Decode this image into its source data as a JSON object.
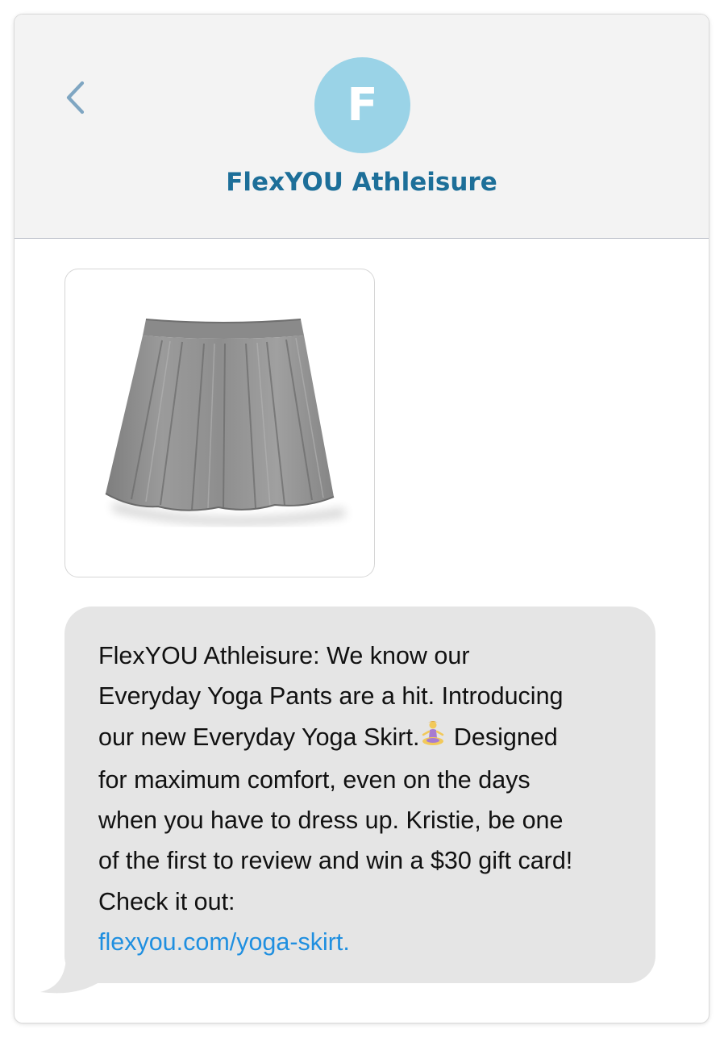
{
  "header": {
    "avatar_letter": "F",
    "sender_name": "FlexYOU Athleisure"
  },
  "message": {
    "line1": "FlexYOU Athleisure: We know our",
    "line2": "Everyday Yoga Pants are a hit. Introducing",
    "line3_before_emoji": "our new Everyday Yoga Skirt.",
    "line3_after_emoji": " Designed",
    "line4": "for maximum comfort, even on the days",
    "line5": "when you have to dress up. Kristie, be one",
    "line6": "of the first to review and win a $30 gift card!",
    "line7": "Check it out:",
    "link": "flexyou.com/yoga-skirt."
  },
  "icons": {
    "back": "chevron-left-icon",
    "emoji": "person-in-lotus-position-emoji"
  },
  "colors": {
    "accent": "#1d6f99",
    "avatar_bg": "#9ad3e7",
    "bubble_bg": "#e5e5e5",
    "link": "#1f8fe0"
  }
}
